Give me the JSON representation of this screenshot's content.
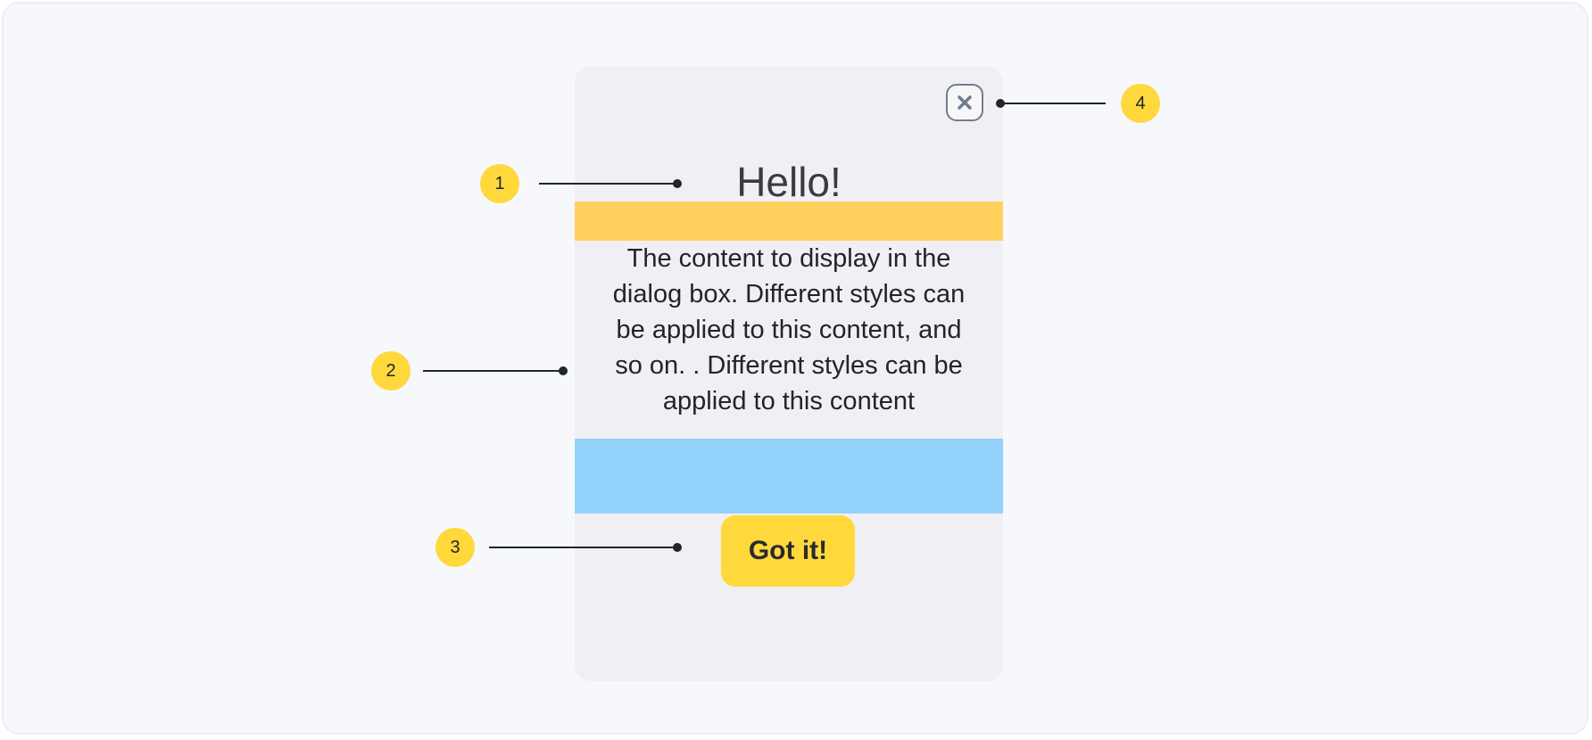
{
  "dialog": {
    "title": "Hello!",
    "content": "The content to display in the dialog box. Different styles can be applied to this content, and so on. . Different styles can be applied to this content",
    "button_label": "Got it!",
    "close_icon": "close-icon"
  },
  "annotations": [
    {
      "label": "1"
    },
    {
      "label": "2"
    },
    {
      "label": "3"
    },
    {
      "label": "4"
    }
  ],
  "colors": {
    "badge": "#ffd93b",
    "button": "#ffd93b",
    "title_band": "#ffd15c",
    "footer_band": "#94d3fb",
    "dialog_bg": "#f0f0f4",
    "page_bg": "#f7f8fc"
  }
}
